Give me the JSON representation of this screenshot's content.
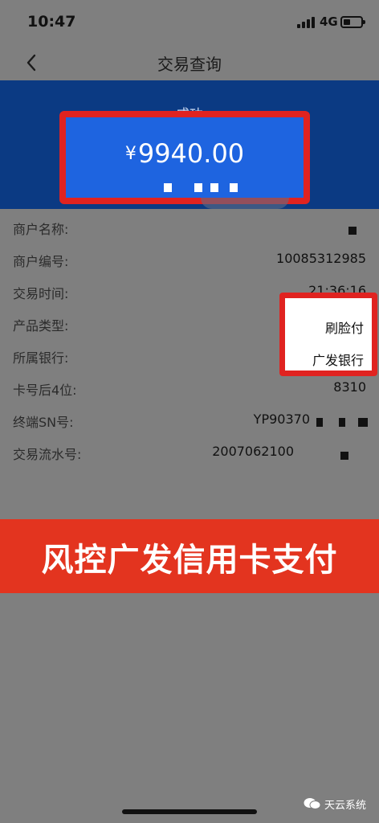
{
  "status_bar": {
    "time": "10:47",
    "network": "4G"
  },
  "nav": {
    "title": "交易查询"
  },
  "banner": {
    "status": "成功",
    "currency_symbol": "¥",
    "amount": "9940.00"
  },
  "rows": [
    {
      "label": "商户名称:",
      "value": ""
    },
    {
      "label": "商户编号:",
      "value": "10085312985"
    },
    {
      "label": "交易时间:",
      "value": "21:36:16"
    },
    {
      "label": "产品类型:",
      "value": "刷脸付"
    },
    {
      "label": "所属银行:",
      "value": "广发银行"
    },
    {
      "label": "卡号后4位:",
      "value": "8310"
    },
    {
      "label": "终端SN号:",
      "value": "YP90370"
    },
    {
      "label": "交易流水号:",
      "value": "2007062100"
    }
  ],
  "promo": {
    "text": "风控广发信用卡支付"
  },
  "watermark": {
    "text": "天云系统"
  },
  "colors": {
    "banner_blue": "#0b3a83",
    "amount_blue": "#1e64e0",
    "highlight_red": "#e02320",
    "promo_red": "#e3341f",
    "overlay_gray": "#7f7f7f"
  }
}
